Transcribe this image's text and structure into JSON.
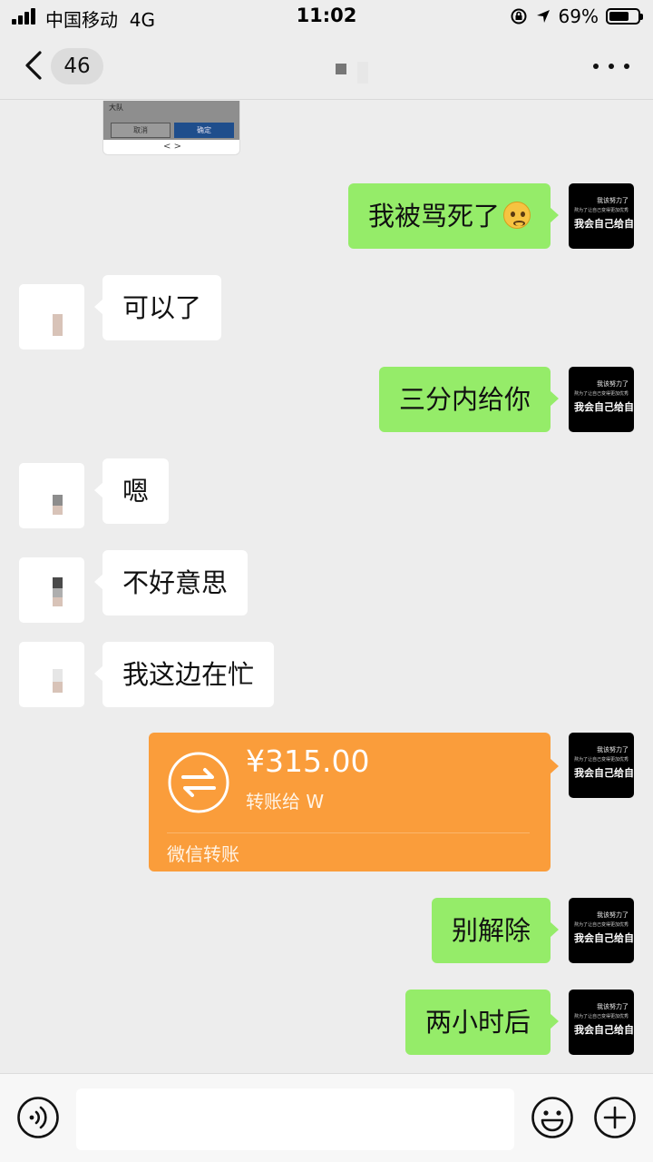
{
  "status_bar": {
    "carrier": "中国移动",
    "network": "4G",
    "time": "11:02",
    "battery": "69%",
    "battery_level": 0.69
  },
  "nav": {
    "unread_count": "46"
  },
  "preview": {
    "mini_title": "大队",
    "button_cancel": "取消",
    "button_confirm": "确定",
    "pager": "<     >"
  },
  "avatar_me": {
    "line1": "我该努力了",
    "line2": "熬为了让自己变得更加优秀",
    "line3": "我会自己给自己"
  },
  "messages": [
    {
      "from": "me",
      "text": "我被骂死了",
      "emoji": "pleading-face-emoji"
    },
    {
      "from": "them",
      "text": "可以了"
    },
    {
      "from": "me",
      "text": "三分内给你"
    },
    {
      "from": "them",
      "text": "嗯"
    },
    {
      "from": "them",
      "text": "不好意思"
    },
    {
      "from": "them",
      "text": "我这边在忙"
    },
    {
      "from": "me",
      "type": "transfer",
      "amount": "¥315.00",
      "recipient": "转账给 W",
      "footer": "微信转账"
    },
    {
      "from": "me",
      "text": "别解除"
    },
    {
      "from": "me",
      "text": "两小时后"
    }
  ],
  "colors": {
    "background": "#ededed",
    "my_bubble": "#95ec69",
    "their_bubble": "#ffffff",
    "transfer": "#fa9d3b"
  },
  "input": {
    "value": "",
    "placeholder": ""
  }
}
